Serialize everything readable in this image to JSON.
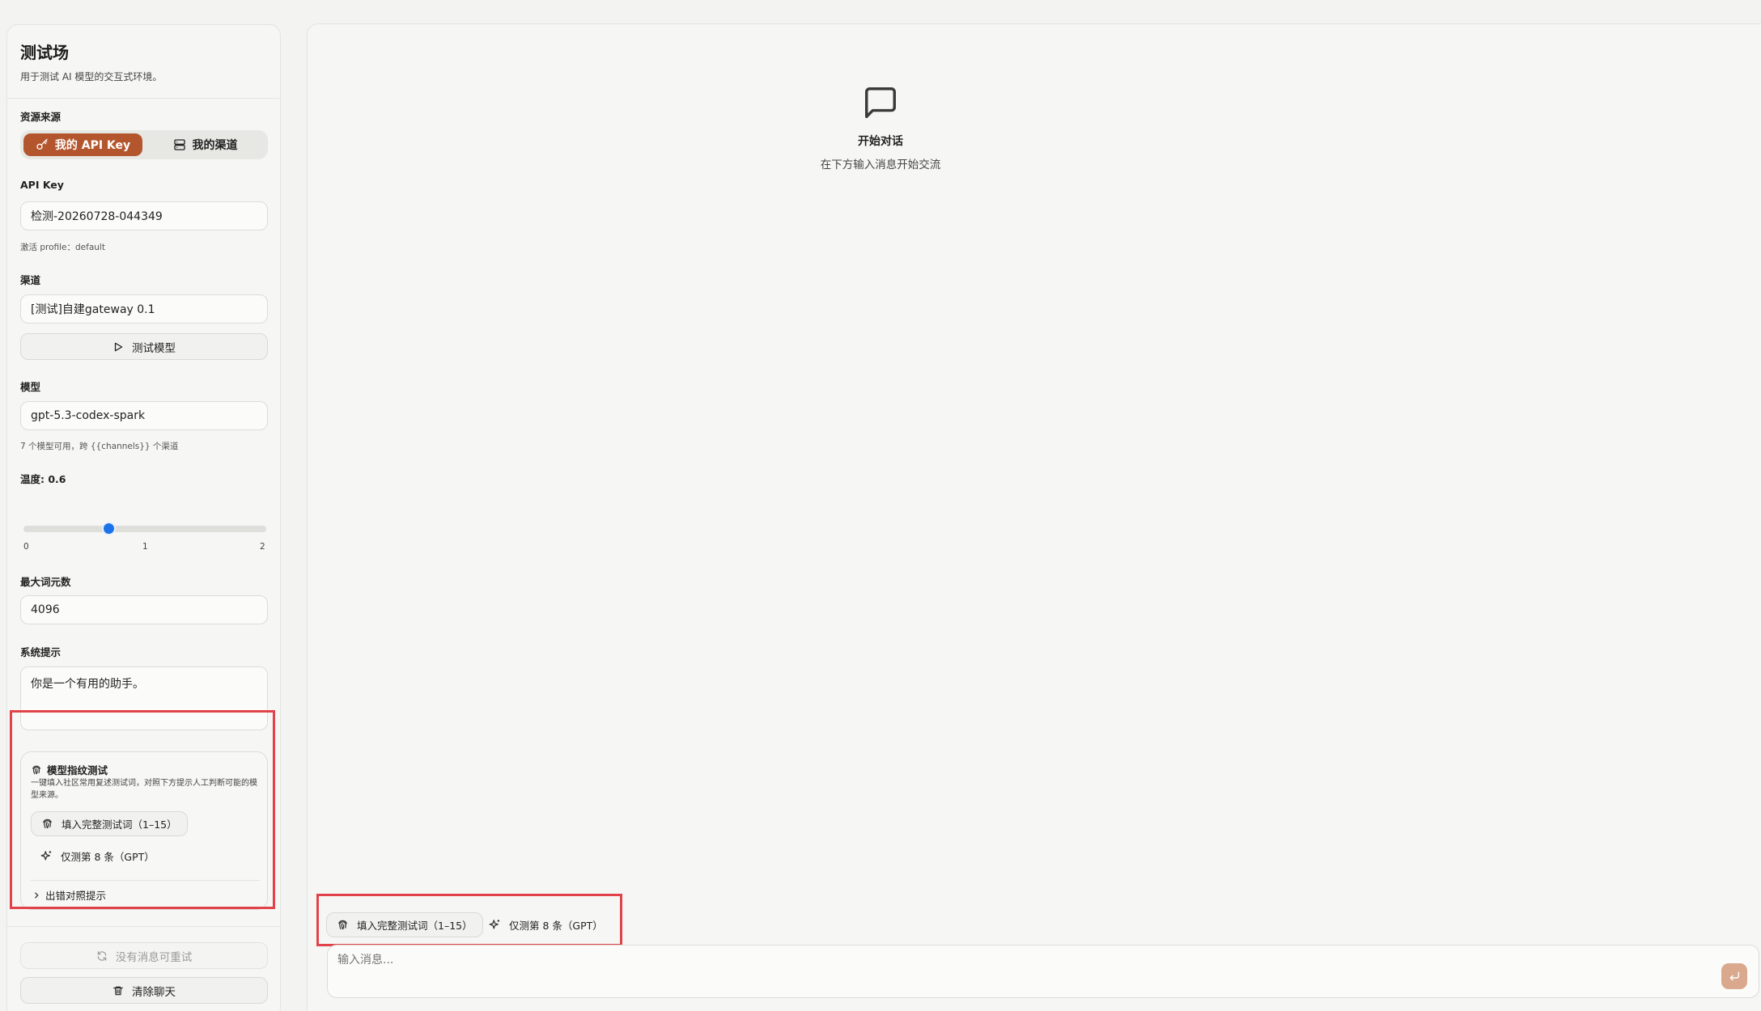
{
  "sidebar": {
    "title": "测试场",
    "subtitle": "用于测试 AI 模型的交互式环境。",
    "source_label": "资源来源",
    "source_tabs": [
      {
        "label": "我的 API Key",
        "icon": "key-icon",
        "active": true
      },
      {
        "label": "我的渠道",
        "icon": "server-icon",
        "active": false
      }
    ],
    "api_key_label": "API Key",
    "api_key_value": "检测-20260728-044349",
    "active_profile": "激活 profile：default",
    "channel_label": "渠道",
    "channel_value": "[测试]自建gateway 0.1",
    "test_model_button": "测试模型",
    "model_label": "模型",
    "model_value": "gpt-5.3-codex-spark",
    "model_hint": "7 个模型可用，跨 {{channels}} 个渠道",
    "temperature_label": "温度: 0.6",
    "temperature_value": 0.6,
    "temperature_min": 0,
    "temperature_max": 2,
    "temperature_ticks": [
      "0",
      "1",
      "2"
    ],
    "max_tokens_label": "最大词元数",
    "max_tokens_value": "4096",
    "system_prompt_label": "系统提示",
    "system_prompt_value": "你是一个有用的助手。",
    "fingerprint": {
      "title": "模型指纹测试",
      "description": "一键填入社区常用复述测试词，对照下方提示人工判断可能的模型来源。",
      "fill_full_button": "填入完整测试词（1–15）",
      "test_gpt_button": "仅测第 8 条（GPT）",
      "compare_hint": "出错对照提示"
    },
    "retry_button": "没有消息可重试",
    "clear_button": "清除聊天"
  },
  "main": {
    "empty_title": "开始对话",
    "empty_subtitle": "在下方输入消息开始交流",
    "quick_fill_full": "填入完整测试词（1–15）",
    "quick_test_gpt": "仅测第 8 条（GPT）",
    "composer_placeholder": "输入消息..."
  },
  "colors": {
    "accent": "#b4562d",
    "slider": "#1a73e8",
    "highlight": "#e2434b",
    "send_button": "#d9a88d"
  }
}
